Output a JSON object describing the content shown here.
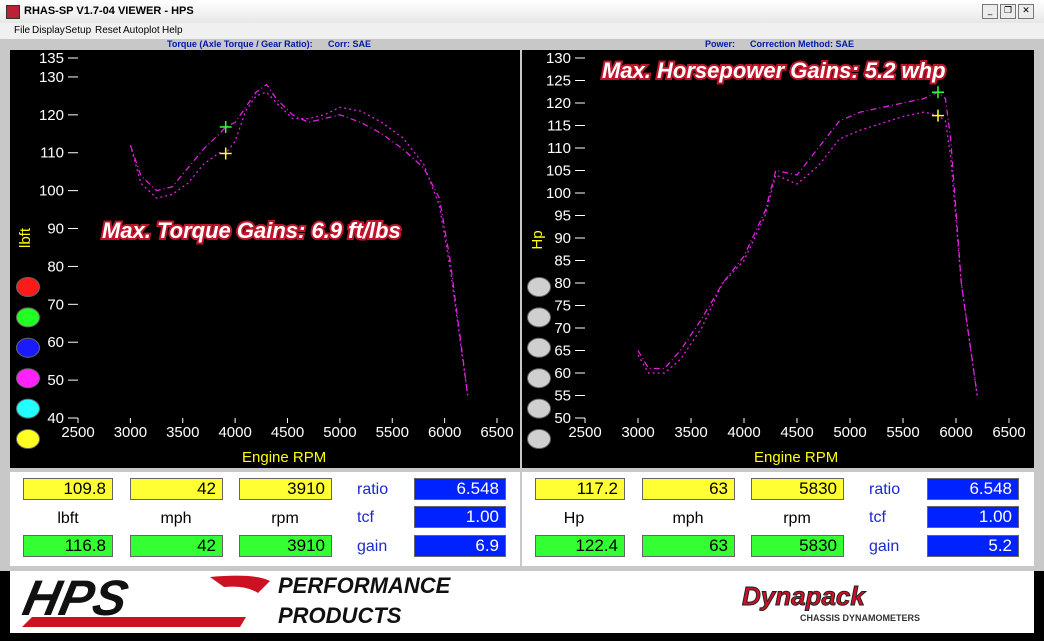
{
  "window": {
    "title": "RHAS-SP V1.7-04  VIEWER - HPS"
  },
  "menu": [
    "File",
    "Display",
    "Setup",
    "Reset",
    "Autoplot",
    "Help"
  ],
  "left_panel": {
    "header_title": "Torque (Axle Torque / Gear Ratio):",
    "header_corr": "Corr: SAE",
    "annotation": "Max. Torque Gains: 6.9 ft/lbs",
    "buttons": [
      {
        "name": "red-button",
        "color": "#ff1a1a"
      },
      {
        "name": "green-button",
        "color": "#22ff22"
      },
      {
        "name": "blue-button",
        "color": "#1a1aff"
      },
      {
        "name": "magenta-button",
        "color": "#ff22ff"
      },
      {
        "name": "cyan-button",
        "color": "#22ffff"
      },
      {
        "name": "yellow-button",
        "color": "#ffff22"
      }
    ],
    "values": {
      "row1": [
        "109.8",
        "42",
        "3910"
      ],
      "labels": [
        "lbft",
        "mph",
        "rpm"
      ],
      "row2": [
        "116.8",
        "42",
        "3910"
      ],
      "side_labels": [
        "ratio",
        "tcf",
        "gain"
      ],
      "side_values": [
        "6.548",
        "1.00",
        "6.9"
      ]
    }
  },
  "right_panel": {
    "header_title": "Power:",
    "header_corr": "Correction Method: SAE",
    "annotation": "Max. Horsepower Gains:  5.2 whp",
    "buttons": [
      {
        "name": "gray-button-1",
        "color": "#cfcfcf"
      },
      {
        "name": "gray-button-2",
        "color": "#cfcfcf"
      },
      {
        "name": "gray-button-3",
        "color": "#cfcfcf"
      },
      {
        "name": "gray-button-4",
        "color": "#cfcfcf"
      },
      {
        "name": "gray-button-5",
        "color": "#cfcfcf"
      },
      {
        "name": "gray-button-6",
        "color": "#cfcfcf"
      }
    ],
    "values": {
      "row1": [
        "117.2",
        "63",
        "5830"
      ],
      "labels": [
        "Hp",
        "mph",
        "rpm"
      ],
      "row2": [
        "122.4",
        "63",
        "5830"
      ],
      "side_labels": [
        "ratio",
        "tcf",
        "gain"
      ],
      "side_values": [
        "6.548",
        "1.00",
        "5.2"
      ]
    }
  },
  "footer": {
    "logo_left": "HPS",
    "tagline_line1": "PERFORMANCE",
    "tagline_line2": "PRODUCTS",
    "logo_right": "Dynapack",
    "logo_right_sub": "CHASSIS DYNAMOMETERS"
  },
  "chart_data": [
    {
      "type": "line",
      "xlabel": "Engine RPM",
      "ylabel": "lbft",
      "xlim": [
        2500,
        6500
      ],
      "ylim": [
        40,
        135
      ],
      "xticks": [
        2500,
        3000,
        3500,
        4000,
        4500,
        5000,
        5500,
        6000,
        6500
      ],
      "yticks": [
        40,
        50,
        60,
        70,
        80,
        90,
        100,
        110,
        120,
        130,
        135
      ],
      "grid": false,
      "series": [
        {
          "color": "#e020e0",
          "dash": "2,3",
          "x": [
            3000,
            3100,
            3250,
            3400,
            3550,
            3700,
            3850,
            3910,
            4000,
            4100,
            4200,
            4300,
            4400,
            4550,
            4700,
            4850,
            5000,
            5200,
            5400,
            5600,
            5800,
            5950,
            6050,
            6150,
            6220
          ],
          "y": [
            112,
            102,
            98,
            99,
            102,
            107,
            110,
            109.8,
            113,
            121,
            125,
            126,
            123,
            119,
            119,
            120,
            122,
            121,
            118,
            114,
            107,
            96,
            80,
            60,
            46
          ]
        },
        {
          "color": "#e020e0",
          "dash": "6,3,1,3",
          "x": [
            3000,
            3100,
            3250,
            3400,
            3550,
            3700,
            3850,
            3910,
            4000,
            4100,
            4200,
            4300,
            4400,
            4550,
            4700,
            4850,
            5000,
            5200,
            5400,
            5600,
            5800,
            5950,
            6050,
            6150,
            6220
          ],
          "y": [
            112,
            104,
            100,
            101,
            106,
            111,
            115,
            116.8,
            118,
            122,
            126,
            128,
            124,
            120,
            118,
            119,
            120,
            118,
            115,
            111,
            106,
            98,
            82,
            61,
            46
          ]
        }
      ],
      "markers": [
        {
          "x": 3910,
          "y": 116.8,
          "color": "#33ff33"
        },
        {
          "x": 3910,
          "y": 109.8,
          "color": "#ffff33"
        }
      ]
    },
    {
      "type": "line",
      "xlabel": "Engine RPM",
      "ylabel": "Hp",
      "xlim": [
        2500,
        6500
      ],
      "ylim": [
        50,
        130
      ],
      "xticks": [
        2500,
        3000,
        3500,
        4000,
        4500,
        5000,
        5500,
        6000,
        6500
      ],
      "yticks": [
        50,
        55,
        60,
        65,
        70,
        75,
        80,
        85,
        90,
        95,
        100,
        105,
        110,
        115,
        120,
        125,
        130
      ],
      "grid": false,
      "series": [
        {
          "color": "#e020e0",
          "dash": "2,3",
          "x": [
            3000,
            3100,
            3250,
            3400,
            3600,
            3800,
            4000,
            4200,
            4300,
            4500,
            4700,
            4900,
            5100,
            5300,
            5500,
            5700,
            5830,
            5900,
            5950,
            6050,
            6200
          ],
          "y": [
            64,
            60,
            60,
            63,
            70,
            80,
            85,
            95,
            104,
            102,
            106,
            112,
            114,
            115.5,
            117,
            118,
            117.2,
            116,
            108,
            80,
            55
          ]
        },
        {
          "color": "#e020e0",
          "dash": "6,3,1,3",
          "x": [
            3000,
            3100,
            3250,
            3400,
            3600,
            3800,
            4000,
            4200,
            4300,
            4500,
            4700,
            4900,
            5100,
            5300,
            5500,
            5700,
            5830,
            5900,
            5950,
            6050,
            6200
          ],
          "y": [
            65,
            61,
            61,
            65,
            72,
            80,
            86,
            96,
            105,
            104,
            110,
            116,
            118,
            119,
            120,
            121,
            122.4,
            121,
            112,
            80,
            55
          ]
        }
      ],
      "markers": [
        {
          "x": 5830,
          "y": 122.4,
          "color": "#33ff33"
        },
        {
          "x": 5830,
          "y": 117.2,
          "color": "#ffff33"
        }
      ]
    }
  ]
}
